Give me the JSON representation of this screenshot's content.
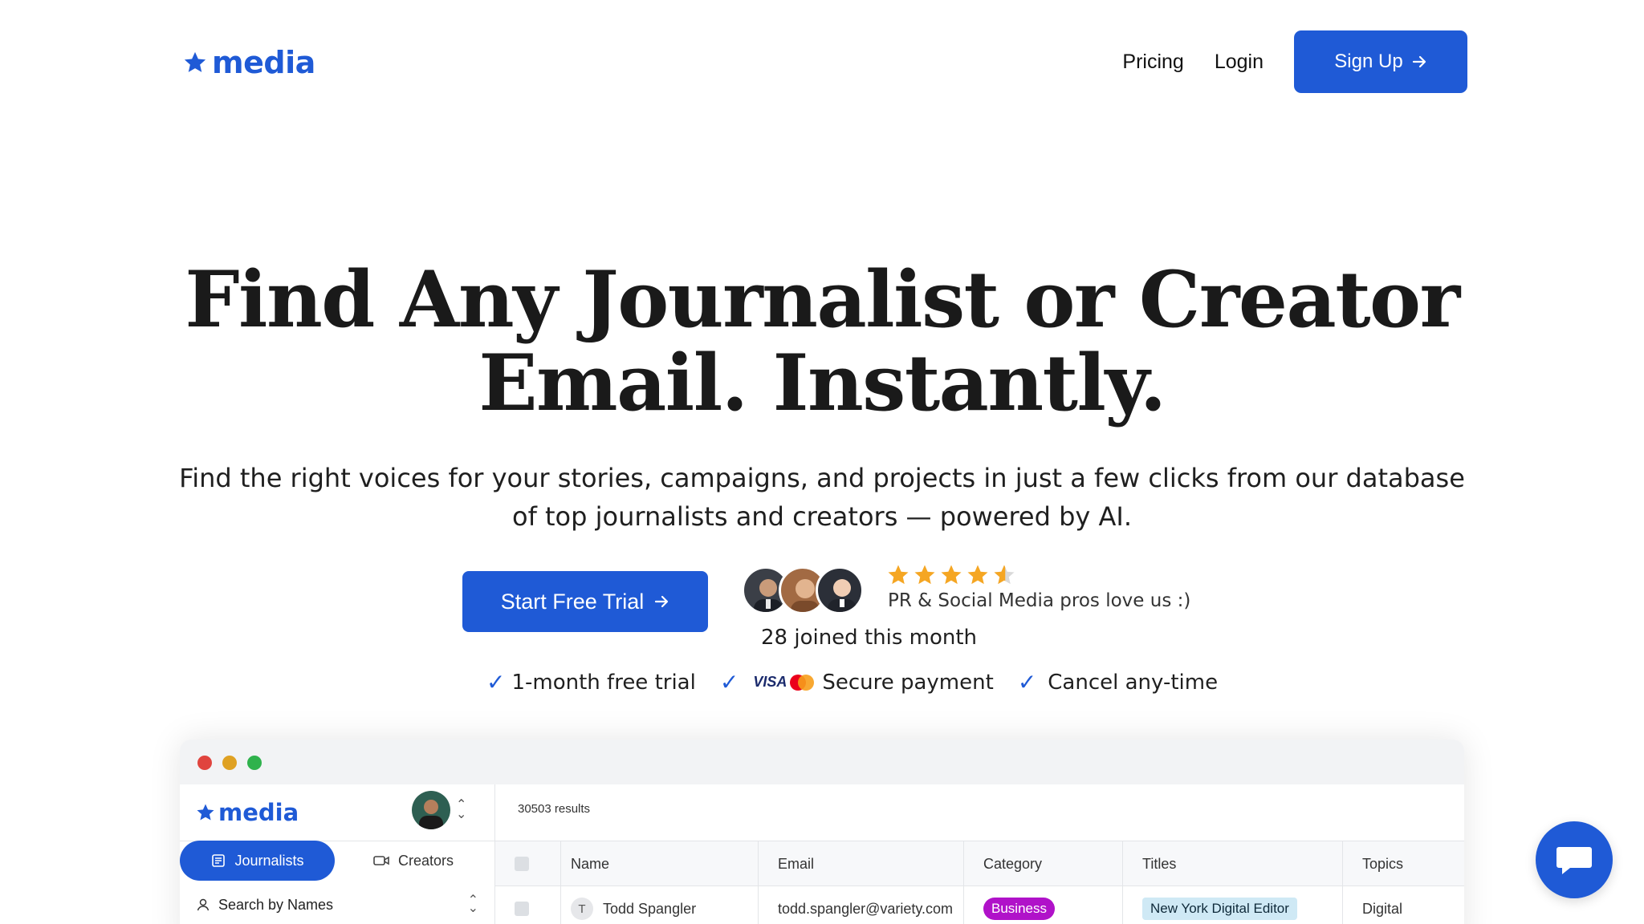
{
  "header": {
    "brand": "media",
    "nav": {
      "pricing": "Pricing",
      "login": "Login",
      "signup": "Sign Up"
    }
  },
  "hero": {
    "title_line1": "Find Any Journalist or Creator",
    "title_line2": "Email. Instantly.",
    "subtitle_line1": "Find the right voices for your stories, campaigns, and projects in just a few clicks from our database",
    "subtitle_line2": "of top journalists and creators — powered by AI.",
    "cta": "Start Free Trial",
    "rating_text": "PR & Social Media pros love us :)",
    "joined": "28 joined this month",
    "rating_stars": 4.5
  },
  "features": {
    "trial": "1-month free trial",
    "payment_brand": "VISA",
    "payment": "Secure payment",
    "cancel": "Cancel any-time"
  },
  "app": {
    "brand": "media",
    "tabs": {
      "journalists": "Journalists",
      "creators": "Creators"
    },
    "search_label": "Search by Names",
    "results": "30503 results",
    "columns": [
      "Name",
      "Email",
      "Category",
      "Titles",
      "Topics"
    ],
    "rows": [
      {
        "initial": "T",
        "name": "Todd Spangler",
        "email": "todd.spangler@variety.com",
        "category": "Business",
        "title": "New York Digital Editor",
        "topics": "Digital"
      }
    ]
  },
  "colors": {
    "primary": "#1f5ad6",
    "category_badge": "#b012c9",
    "title_badge": "#cfe9f5",
    "star": "#f5a623"
  },
  "icons": {
    "logo": "star-icon",
    "arrow": "arrow-right-icon",
    "check": "check-icon",
    "chat": "chat-icon"
  }
}
